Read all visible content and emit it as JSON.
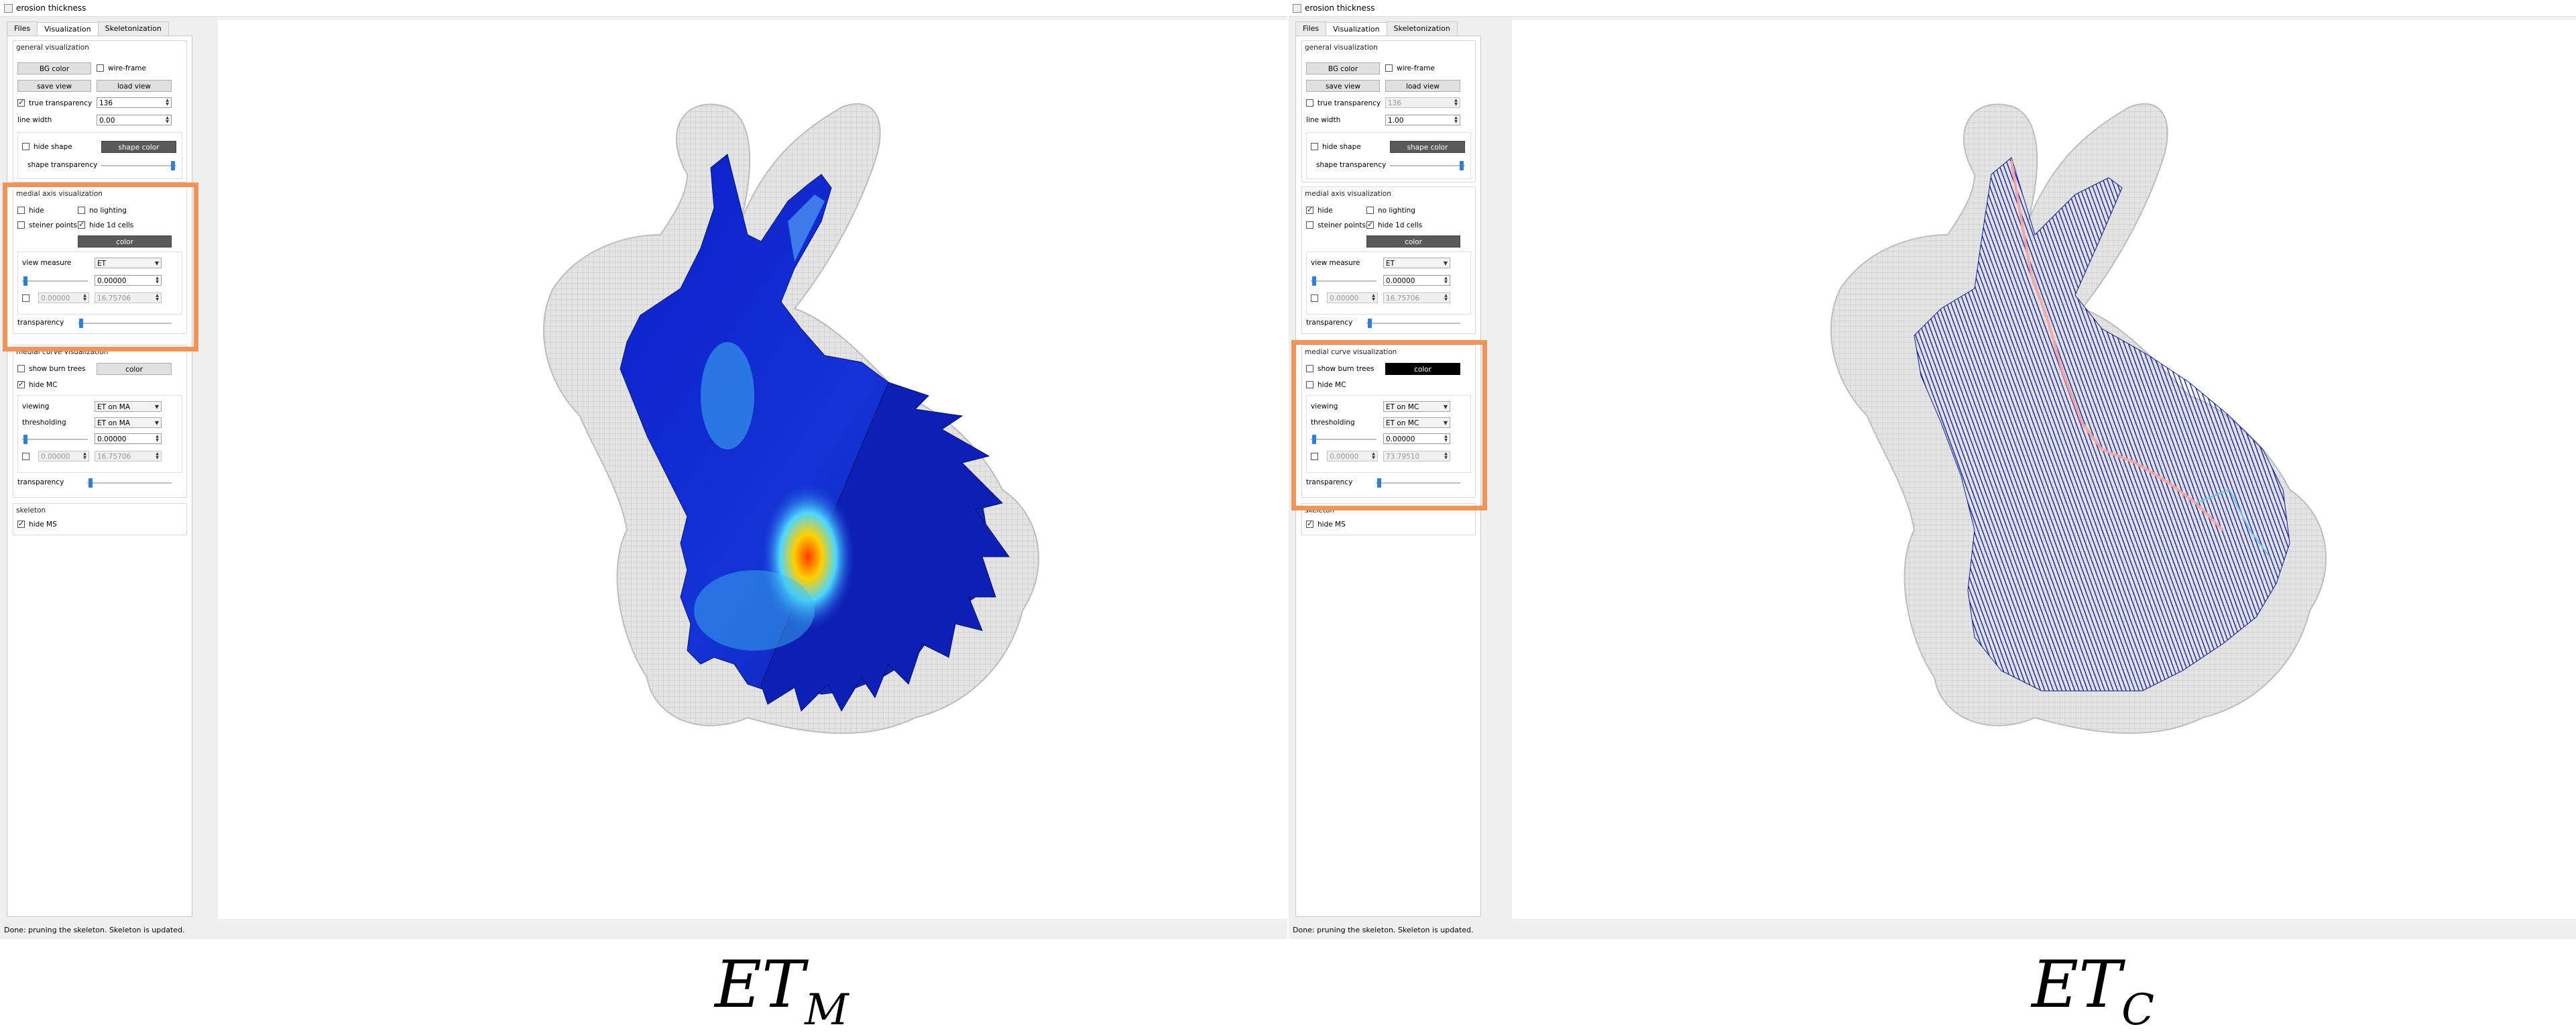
{
  "left": {
    "title": "erosion thickness",
    "tabs": [
      "Files",
      "Visualization",
      "Skeletonization"
    ],
    "general": {
      "title": "general visualization",
      "bg_color": "BG color",
      "wire_frame": "wire-frame",
      "save_view": "save view",
      "load_view": "load view",
      "true_transparency": "true transparency",
      "true_transparency_value": "136",
      "line_width": "line width",
      "line_width_value": "0.00",
      "hide_shape": "hide shape",
      "shape_color": "shape color",
      "shape_transparency": "shape transparency"
    },
    "medial_axis": {
      "title": "medial axis visualization",
      "hide": "hide",
      "no_lighting": "no lighting",
      "steiner_points": "steiner points",
      "hide_1d_cells": "hide 1d cells",
      "color": "color",
      "view_measure": "view measure",
      "view_measure_value": "ET",
      "slider_value": "0.00000",
      "range_min": "0.00000",
      "range_max": "16.75706",
      "transparency": "transparency"
    },
    "medial_curve": {
      "title": "medial curve visualization",
      "show_burn_trees": "show burn trees",
      "color": "color",
      "hide_mc": "hide MC",
      "viewing": "viewing",
      "viewing_value": "ET on MA",
      "thresholding": "thresholding",
      "thresholding_value": "ET on MA",
      "slider_value": "0.00000",
      "range_min": "0.00000",
      "range_max": "16.75706",
      "transparency": "transparency"
    },
    "skeleton": {
      "title": "skeleton",
      "hide_ms": "hide MS"
    },
    "status": "Done: pruning the skeleton. Skeleton is updated."
  },
  "right": {
    "title": "erosion thickness",
    "tabs": [
      "Files",
      "Visualization",
      "Skeletonization"
    ],
    "general": {
      "title": "general visualization",
      "bg_color": "BG color",
      "wire_frame": "wire-frame",
      "save_view": "save view",
      "load_view": "load view",
      "true_transparency": "true transparency",
      "true_transparency_value": "136",
      "line_width": "line width",
      "line_width_value": "1.00",
      "hide_shape": "hide shape",
      "shape_color": "shape color",
      "shape_transparency": "shape transparency"
    },
    "medial_axis": {
      "title": "medial axis visualization",
      "hide": "hide",
      "no_lighting": "no lighting",
      "steiner_points": "steiner points",
      "hide_1d_cells": "hide 1d cells",
      "color": "color",
      "view_measure": "view measure",
      "view_measure_value": "ET",
      "slider_value": "0.00000",
      "range_min": "0.00000",
      "range_max": "16.75706",
      "transparency": "transparency"
    },
    "medial_curve": {
      "title": "medial curve visualization",
      "show_burn_trees": "show burn trees",
      "color": "color",
      "hide_mc": "hide MC",
      "viewing": "viewing",
      "viewing_value": "ET on MC",
      "thresholding": "thresholding",
      "thresholding_value": "ET on MC",
      "slider_value": "0.00000",
      "range_min": "0.00000",
      "range_max": "73.79510",
      "transparency": "transparency"
    },
    "skeleton": {
      "title": "skeleton",
      "hide_ms": "hide MS"
    },
    "status": "Done: pruning the skeleton. Skeleton is updated."
  },
  "captions": {
    "left_main": "ET",
    "left_sub": "M",
    "right_main": "ET",
    "right_sub": "C"
  },
  "colors": {
    "highlight": "#f0945a",
    "medial_axis_blue": "#0a1fb8",
    "burn_tree_blue": "#0d1a9c"
  }
}
